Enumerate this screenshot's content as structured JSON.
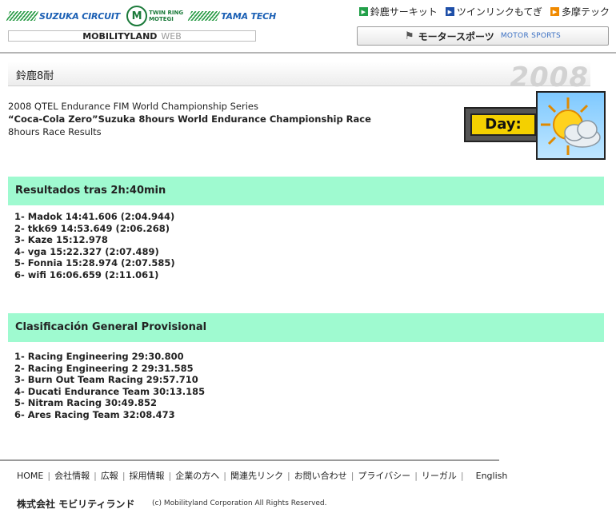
{
  "header": {
    "logos": {
      "suzuka": "SUZUKA CIRCUIT",
      "motegi_small": "TWIN RING",
      "motegi": "MOTEGI",
      "tama": "TAMA TECH"
    },
    "mobilityland": "MOBILITYLAND",
    "web": "WEB",
    "top_links": [
      {
        "label": "鈴鹿サーキット",
        "color": "#23a04a"
      },
      {
        "label": "ツインリンクもてぎ",
        "color": "#1e4fa8"
      },
      {
        "label": "多摩テック",
        "color": "#f08a00"
      }
    ],
    "motor_sports_jp": "モータースポーツ",
    "motor_sports_en": "MOTOR SPORTS"
  },
  "title_bar": {
    "title": "鈴鹿8耐",
    "year": "2008"
  },
  "intro": {
    "line1": "2008 QTEL Endurance FIM World Championship Series",
    "line2": "“Coca-Cola Zero”Suzuka 8hours World Endurance Championship Race",
    "line3": "8hours Race Results"
  },
  "day_badge": {
    "label": "Day:",
    "weather_icon": "sun-behind-cloud-icon"
  },
  "sections": {
    "results": {
      "title": "Resultados tras 2h:40min",
      "items": [
        "1- Madok 14:41.606 (2:04.944)",
        "2- tkk69 14:53.649 (2:06.268)",
        "3- Kaze 15:12.978",
        "4- vga 15:22.327 (2:07.489)",
        "5- Fonnia 15:28.974 (2:07.585)",
        "6- wifi 16:06.659 (2:11.061)"
      ]
    },
    "standings": {
      "title": "Clasificación General Provisional",
      "items": [
        "1- Racing Engineering 29:30.800",
        "2- Racing Engineering 2 29:31.585",
        "3- Burn Out Team Racing 29:57.710",
        "4- Ducati Endurance Team 30:13.185",
        "5- Nitram Racing 30:49.852",
        "6- Ares Racing Team 32:08.473"
      ]
    }
  },
  "footer": {
    "nav": [
      "HOME",
      "会社情報",
      "広報",
      "採用情報",
      "企業の方へ",
      "関連先リンク",
      "お問い合わせ",
      "プライバシー",
      "リーガル"
    ],
    "english": "English",
    "corp_name": "株式会社 モビリティランド",
    "copyright": "(c) Mobilityland Corporation All Rights Reserved."
  },
  "colors": {
    "section_bg": "#9ffad0",
    "day_label_bg": "#f4d000"
  }
}
